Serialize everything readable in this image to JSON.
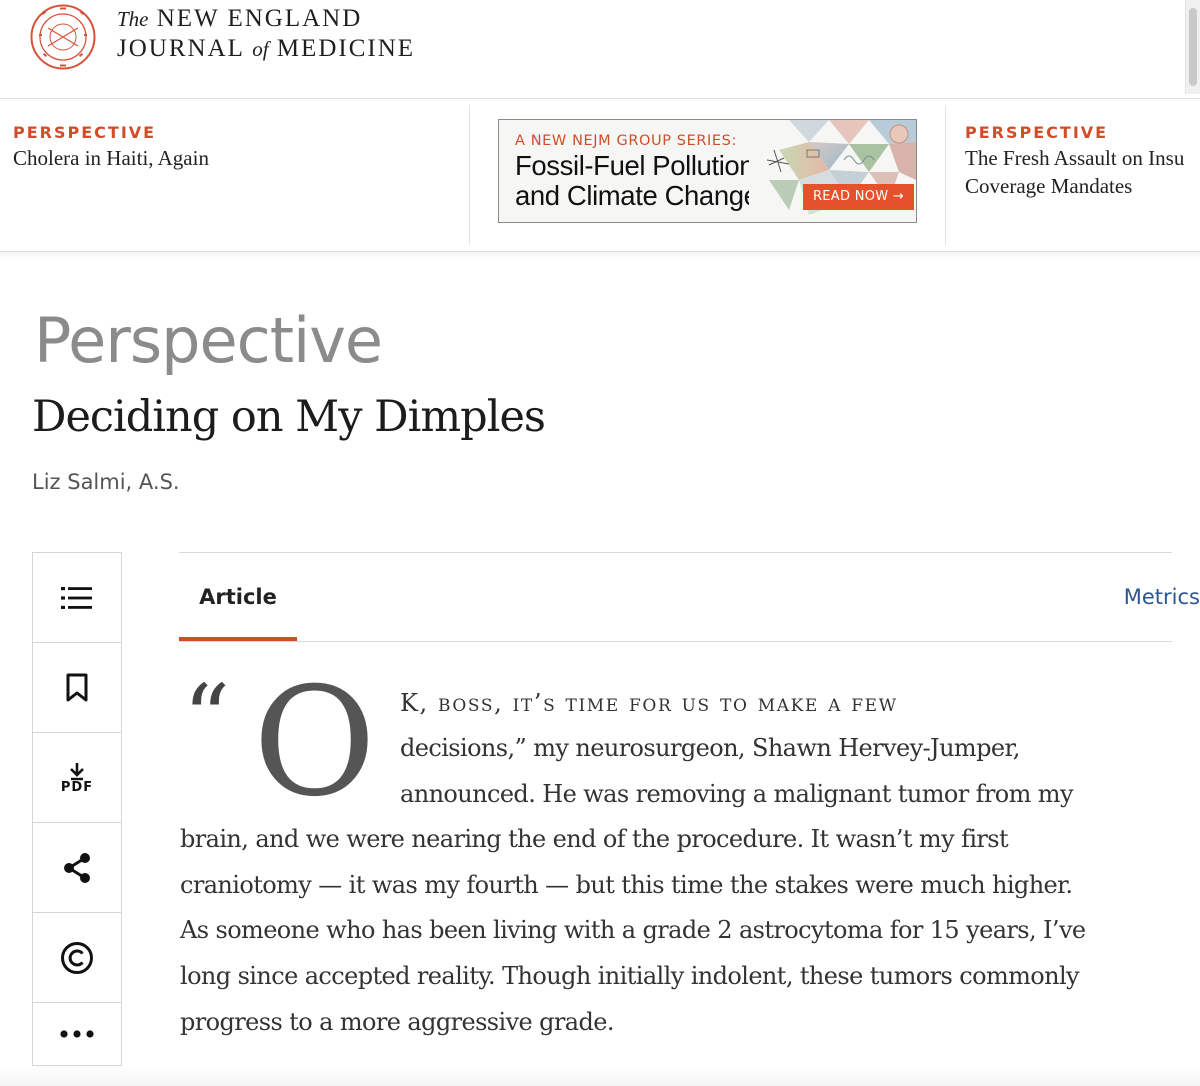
{
  "header": {
    "logo_line1_prefix": "The",
    "logo_line1_main": "NEW ENGLAND",
    "logo_line2_a": "JOURNAL",
    "logo_line2_of": "of",
    "logo_line2_b": "MEDICINE",
    "seal_icon": "nejm-seal-icon"
  },
  "related": [
    {
      "kicker": "PERSPECTIVE",
      "title": "Cholera in Haiti, Again"
    },
    {
      "kicker": "PERSPECTIVE",
      "title_line1": "The Fresh Assault on Insu",
      "title_line2": "Coverage Mandates"
    }
  ],
  "ad": {
    "eyebrow": "A NEW NEJM GROUP SERIES:",
    "title_line1": "Fossil-Fuel Pollution",
    "title_line2": "and Climate Change",
    "cta": "READ NOW →"
  },
  "article": {
    "section": "Perspective",
    "title": "Deciding on My Dimples",
    "author": "Liz Salmi, A.S."
  },
  "rail": {
    "icons": [
      "list-icon",
      "bookmark-icon",
      "pdf-download-icon",
      "share-icon",
      "copyright-icon",
      "more-icon"
    ],
    "pdf_label": "PDF"
  },
  "tabs": {
    "article": "Article",
    "metrics": "Metrics"
  },
  "body": {
    "dropcap_quote": "“",
    "dropcap_letter": "O",
    "line1_sc": "K, boss, it’s time for us to make a few",
    "line2": "decisions,” my neurosurgeon, Shawn Hervey-Jumper,",
    "line3": "announced. He was removing a malignant tumor from my",
    "line4": "brain, and we were nearing the end of the procedure. It wasn’t my first",
    "line5": "craniotomy — it was my fourth — but this time the stakes were much higher.",
    "line6": "As someone who has been living with a grade 2 astrocytoma for 15 years, I’ve",
    "line7": "long since accepted reality. Though initially indolent, these tumors commonly",
    "line8": "progress to a more aggressive grade."
  },
  "colors": {
    "accent": "#d14d2a",
    "link": "#2d5792",
    "section_gray": "#8b8b8b"
  }
}
